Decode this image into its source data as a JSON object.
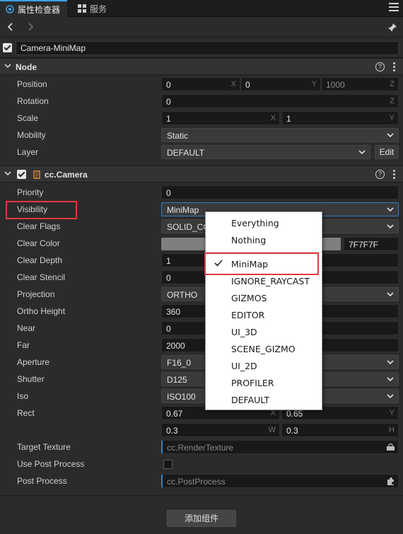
{
  "tabs": [
    {
      "label": "属性检查器",
      "icon": "inspector-icon",
      "active": true
    },
    {
      "label": "服务",
      "icon": "services-icon",
      "active": false
    }
  ],
  "node_name": "Camera-MiniMap",
  "node_section": {
    "title": "Node",
    "position": {
      "label": "Position",
      "x": "0",
      "y": "0",
      "z": "1000"
    },
    "rotation": {
      "label": "Rotation",
      "value": "0",
      "axis": "Z"
    },
    "scale": {
      "label": "Scale",
      "x": "1",
      "y": "1"
    },
    "mobility": {
      "label": "Mobility",
      "value": "Static"
    },
    "layer": {
      "label": "Layer",
      "value": "DEFAULT",
      "edit_label": "Edit"
    }
  },
  "camera_section": {
    "title": "cc.Camera",
    "priority": {
      "label": "Priority",
      "value": "0"
    },
    "visibility": {
      "label": "Visibility",
      "value": "MiniMap"
    },
    "clear_flags": {
      "label": "Clear Flags",
      "value": "SOLID_CO"
    },
    "clear_color": {
      "label": "Clear Color",
      "hex": "7F7F7F",
      "color": "#7f7f7f"
    },
    "clear_depth": {
      "label": "Clear Depth",
      "value": "1"
    },
    "clear_stencil": {
      "label": "Clear Stencil",
      "value": "0"
    },
    "projection": {
      "label": "Projection",
      "value": "ORTHO"
    },
    "ortho_height": {
      "label": "Ortho Height",
      "value": "360"
    },
    "near": {
      "label": "Near",
      "value": "0"
    },
    "far": {
      "label": "Far",
      "value": "2000"
    },
    "aperture": {
      "label": "Aperture",
      "value": "F16_0"
    },
    "shutter": {
      "label": "Shutter",
      "value": "D125"
    },
    "iso": {
      "label": "Iso",
      "value": "ISO100"
    },
    "rect": {
      "label": "Rect",
      "x": "0.67",
      "y": "0.65",
      "w": "0.3",
      "h": "0.3"
    },
    "target_texture": {
      "label": "Target Texture",
      "placeholder": "cc.RenderTexture"
    },
    "use_post_process": {
      "label": "Use Post Process",
      "checked": false
    },
    "post_process": {
      "label": "Post Process",
      "placeholder": "cc.PostProcess"
    }
  },
  "axis_labels": {
    "x": "X",
    "y": "Y",
    "z": "Z",
    "w": "W",
    "h": "H"
  },
  "visibility_menu": {
    "items": [
      "Everything",
      "Nothing",
      "MiniMap",
      "IGNORE_RAYCAST",
      "GIZMOS",
      "EDITOR",
      "UI_3D",
      "SCENE_GIZMO",
      "UI_2D",
      "PROFILER",
      "DEFAULT"
    ],
    "selected": "MiniMap"
  },
  "add_component_label": "添加组件",
  "help_glyph": "?",
  "highlight_color": "#e0393e"
}
